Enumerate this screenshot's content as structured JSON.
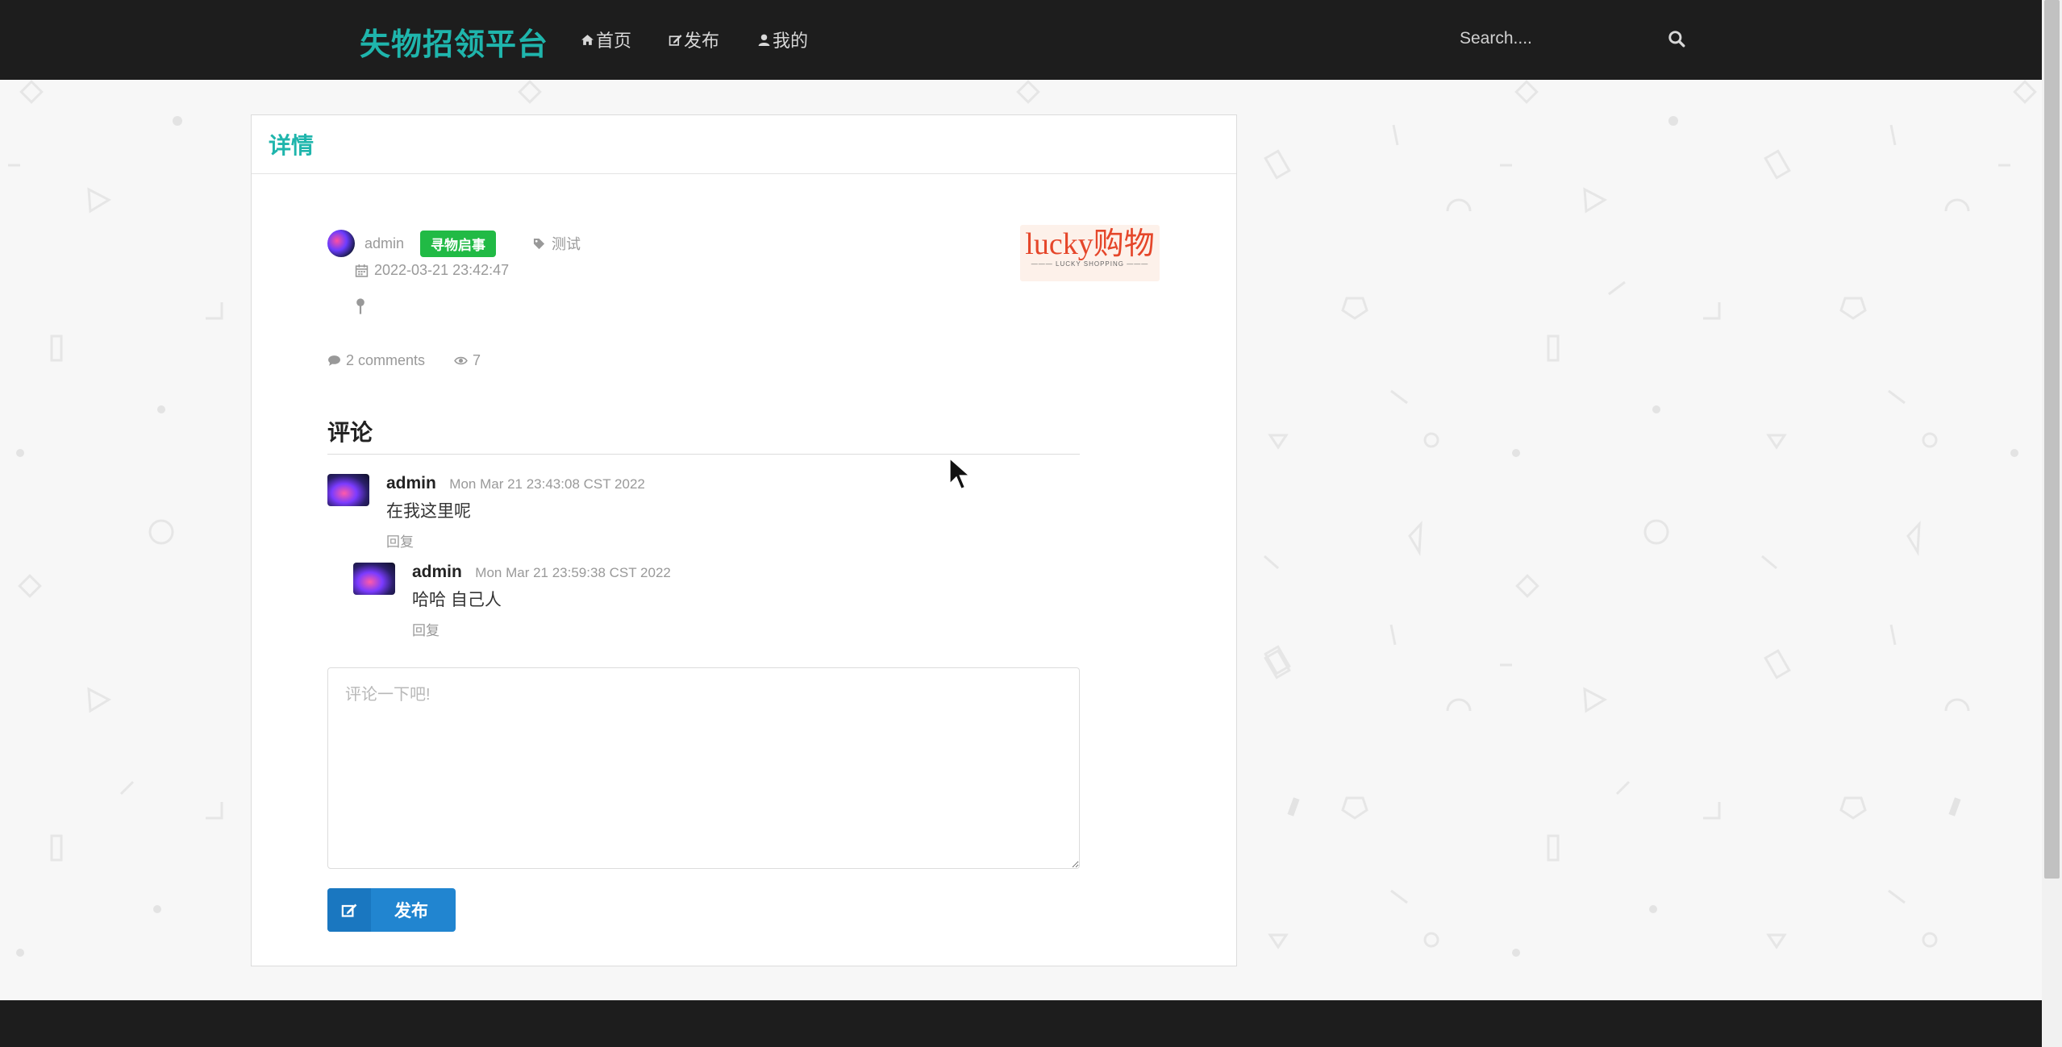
{
  "navbar": {
    "brand": "失物招领平台",
    "items": [
      {
        "label": "首页",
        "icon": "home-icon"
      },
      {
        "label": "发布",
        "icon": "edit-icon"
      },
      {
        "label": "我的",
        "icon": "user-icon"
      }
    ],
    "search": {
      "placeholder": "Search....",
      "icon": "search-icon"
    }
  },
  "detail": {
    "title": "详情",
    "author": "admin",
    "type_badge": "寻物启事",
    "category": "测试",
    "date": "2022-03-21 23:42:47",
    "comments_count": "2 comments",
    "views": "7",
    "logo": {
      "main": "lucky购物",
      "sub": "——— LUCKY SHOPPING ———"
    }
  },
  "comments": {
    "title": "评论",
    "items": [
      {
        "author": "admin",
        "time": "Mon Mar 21 23:43:08 CST 2022",
        "text": "在我这里呢",
        "reply": "回复"
      },
      {
        "author": "admin",
        "time": "Mon Mar 21 23:59:38 CST 2022",
        "text": "哈哈 自己人",
        "reply": "回复"
      }
    ]
  },
  "form": {
    "placeholder": "评论一下吧!",
    "submit_label": "发布"
  },
  "colors": {
    "brand": "#1fb5ac",
    "navbar_bg": "#1d1d1d",
    "badge_green": "#21ba45",
    "button_blue": "#2185d0"
  }
}
